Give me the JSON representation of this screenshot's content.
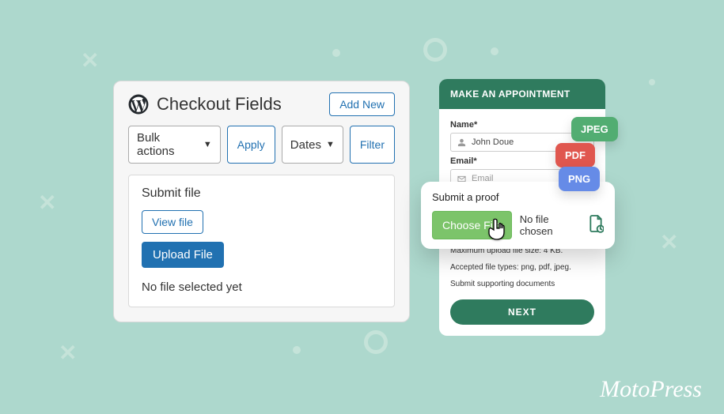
{
  "admin": {
    "title": "Checkout Fields",
    "add_new": "Add New",
    "bulk_actions": "Bulk actions",
    "apply": "Apply",
    "dates": "Dates",
    "filter": "Filter",
    "card": {
      "title": "Submit file",
      "view_file": "View file",
      "upload_file": "Upload File",
      "no_file": "No file selected yet"
    }
  },
  "appt": {
    "header": "MAKE AN APPOINTMENT",
    "name_label": "Name*",
    "name_value": "John Doue",
    "email_label": "Email*",
    "email_placeholder": "Email",
    "help_max": "Maximum upload file size: 4 KB.",
    "help_types": "Accepted file types: png, pdf, jpeg.",
    "help_docs": "Submit supporting documents",
    "next": "NEXT"
  },
  "proof": {
    "title": "Submit a proof",
    "choose": "Choose File",
    "status": "No file chosen"
  },
  "pills": {
    "jpeg": "JPEG",
    "pdf": "PDF",
    "png": "PNG"
  },
  "brand": "MotoPress"
}
